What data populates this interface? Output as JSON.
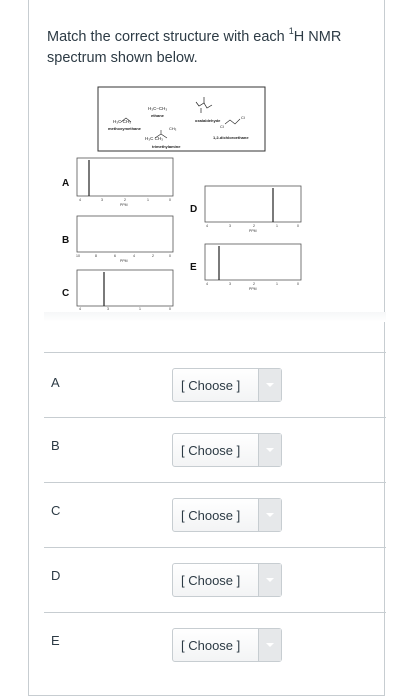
{
  "question": {
    "text_before": "Match the correct structure with each ",
    "sup": "1",
    "text_after": "H NMR spectrum shown below."
  },
  "figure": {
    "structures": {
      "methoxymethane": "methoxymethane",
      "ethane": "ethane",
      "oxalaldehyde": "oxalaldehyde",
      "trimethylamine": "trimethylamine",
      "dichloroethane": "1,2-dichloroethane",
      "ethane_formula": "H₃C–CH₃",
      "methoxy_formula": "H₃C  CH₃",
      "amine_ch3": "CH₃",
      "amine_formula": "H₃C  CH₃"
    },
    "spectra_labels": [
      "A",
      "B",
      "C",
      "D",
      "E"
    ],
    "ppm_label": "PPM",
    "ticks": {
      "A": [
        "4",
        "3",
        "2",
        "1",
        "0"
      ],
      "B": [
        "10",
        "8",
        "6",
        "4",
        "2",
        "0"
      ],
      "C": [
        "4",
        "3",
        "2",
        "1",
        "0"
      ],
      "D": [
        "4",
        "3",
        "2",
        "1",
        "0"
      ],
      "E": [
        "4",
        "3",
        "2",
        "1",
        "0"
      ]
    }
  },
  "rows": [
    {
      "label": "A",
      "value": "[ Choose ]"
    },
    {
      "label": "B",
      "value": "[ Choose ]"
    },
    {
      "label": "C",
      "value": "[ Choose ]"
    },
    {
      "label": "D",
      "value": "[ Choose ]"
    },
    {
      "label": "E",
      "value": "[ Choose ]"
    }
  ]
}
